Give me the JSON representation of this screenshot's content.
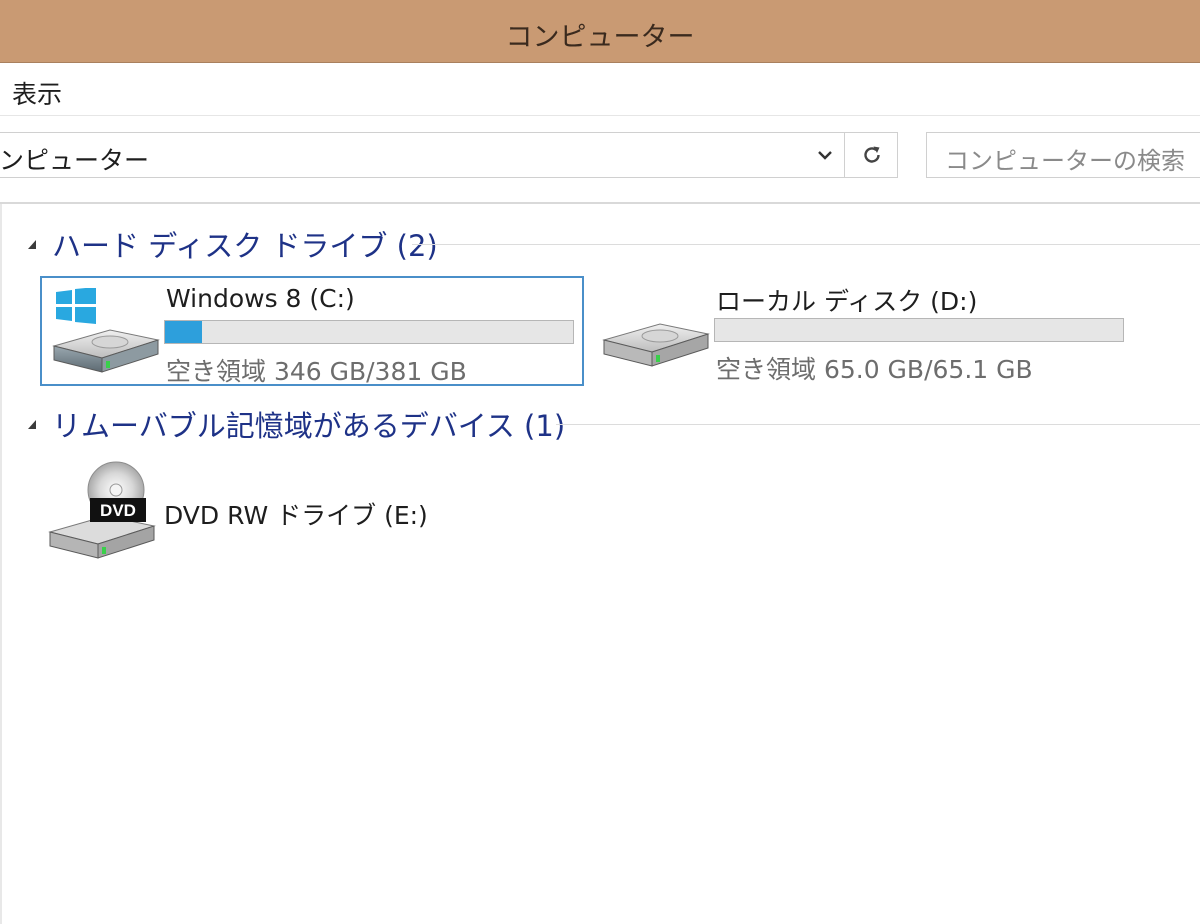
{
  "window": {
    "title": "コンピューター"
  },
  "ribbon": {
    "tab_view": "表示"
  },
  "address_bar": {
    "path": "ンピューター"
  },
  "search": {
    "placeholder": "コンピューターの検索"
  },
  "groups": {
    "hard_disks": {
      "label": "ハード ディスク ドライブ (2)",
      "drives": [
        {
          "name": "Windows 8 (C:)",
          "space": "空き領域 346 GB/381 GB",
          "used_fraction": 0.09,
          "selected": true
        },
        {
          "name": "ローカル ディスク (D:)",
          "space": "空き領域 65.0 GB/65.1 GB",
          "used_fraction": 0.0,
          "selected": false
        }
      ]
    },
    "removable": {
      "label": "リムーバブル記憶域があるデバイス (1)",
      "devices": [
        {
          "name": "DVD RW ドライブ (E:)",
          "badge": "DVD"
        }
      ]
    }
  },
  "colors": {
    "titlebar": "#c99a73",
    "group_header_text": "#1e3287",
    "usage_bar_fill": "#2d9fdc",
    "selection_border": "#4a8fc9",
    "windows_logo": "#29a8e0"
  },
  "icons": {
    "dropdown": "chevron-down-icon",
    "refresh": "refresh-icon",
    "collapse": "collapse-triangle-icon",
    "hard_drive": "hard-drive-icon",
    "windows_logo": "windows-logo-icon",
    "dvd_drive": "dvd-drive-icon"
  }
}
